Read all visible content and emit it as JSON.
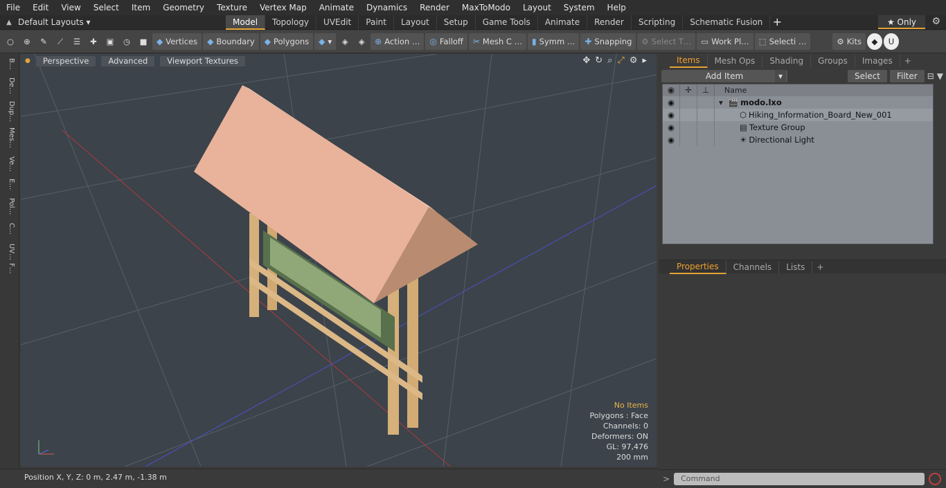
{
  "menu": [
    "File",
    "Edit",
    "View",
    "Select",
    "Item",
    "Geometry",
    "Texture",
    "Vertex Map",
    "Animate",
    "Dynamics",
    "Render",
    "MaxToModo",
    "Layout",
    "System",
    "Help"
  ],
  "layouts": {
    "label": "Default Layouts ▾"
  },
  "tabs": [
    {
      "label": "Model",
      "active": true
    },
    {
      "label": "Topology"
    },
    {
      "label": "UVEdit"
    },
    {
      "label": "Paint"
    },
    {
      "label": "Layout"
    },
    {
      "label": "Setup"
    },
    {
      "label": "Game Tools"
    },
    {
      "label": "Animate"
    },
    {
      "label": "Render"
    },
    {
      "label": "Scripting"
    },
    {
      "label": "Schematic Fusion"
    }
  ],
  "only_label": "★ Only",
  "toolbar": {
    "vertices": "Vertices",
    "boundary": "Boundary",
    "polygons": "Polygons",
    "action": "Action  …",
    "falloff": "Falloff",
    "meshc": "Mesh C …",
    "symm": "Symm …",
    "snapping": "Snapping",
    "selectt": "Select T…",
    "workpl": "Work Pl…",
    "selecti": "Selecti …",
    "kits": "Kits"
  },
  "leftstrip": [
    "B…",
    "De…",
    "Dup…",
    "Mes…",
    "Ve…",
    "E…",
    "Pol…",
    "C…",
    "UV…",
    "F…"
  ],
  "viewport": {
    "perspective": "Perspective",
    "advanced": "Advanced",
    "textures": "Viewport Textures",
    "hud": [
      "No Items",
      "Polygons : Face",
      "Channels: 0",
      "Deformers: ON",
      "GL: 97,476",
      "200 mm"
    ]
  },
  "status": "Position X, Y, Z:   0 m, 2.47 m, -1.38 m",
  "rp": {
    "tabs": [
      "Items",
      "Mesh Ops",
      "Shading",
      "Groups",
      "Images"
    ],
    "add_item": "Add Item",
    "select": "Select",
    "filter": "Filter",
    "name_col": "Name",
    "items": [
      {
        "label": "modo.lxo"
      },
      {
        "label": "Hiking_Information_Board_New_001"
      },
      {
        "label": "Texture Group"
      },
      {
        "label": "Directional Light"
      }
    ],
    "tabs2": [
      "Properties",
      "Channels",
      "Lists"
    ],
    "command": "Command"
  },
  "colors": {
    "accent": "#e5a335",
    "viewport": "#3c434a",
    "roof": "#e9b29a",
    "pole": "#d8b27c"
  }
}
